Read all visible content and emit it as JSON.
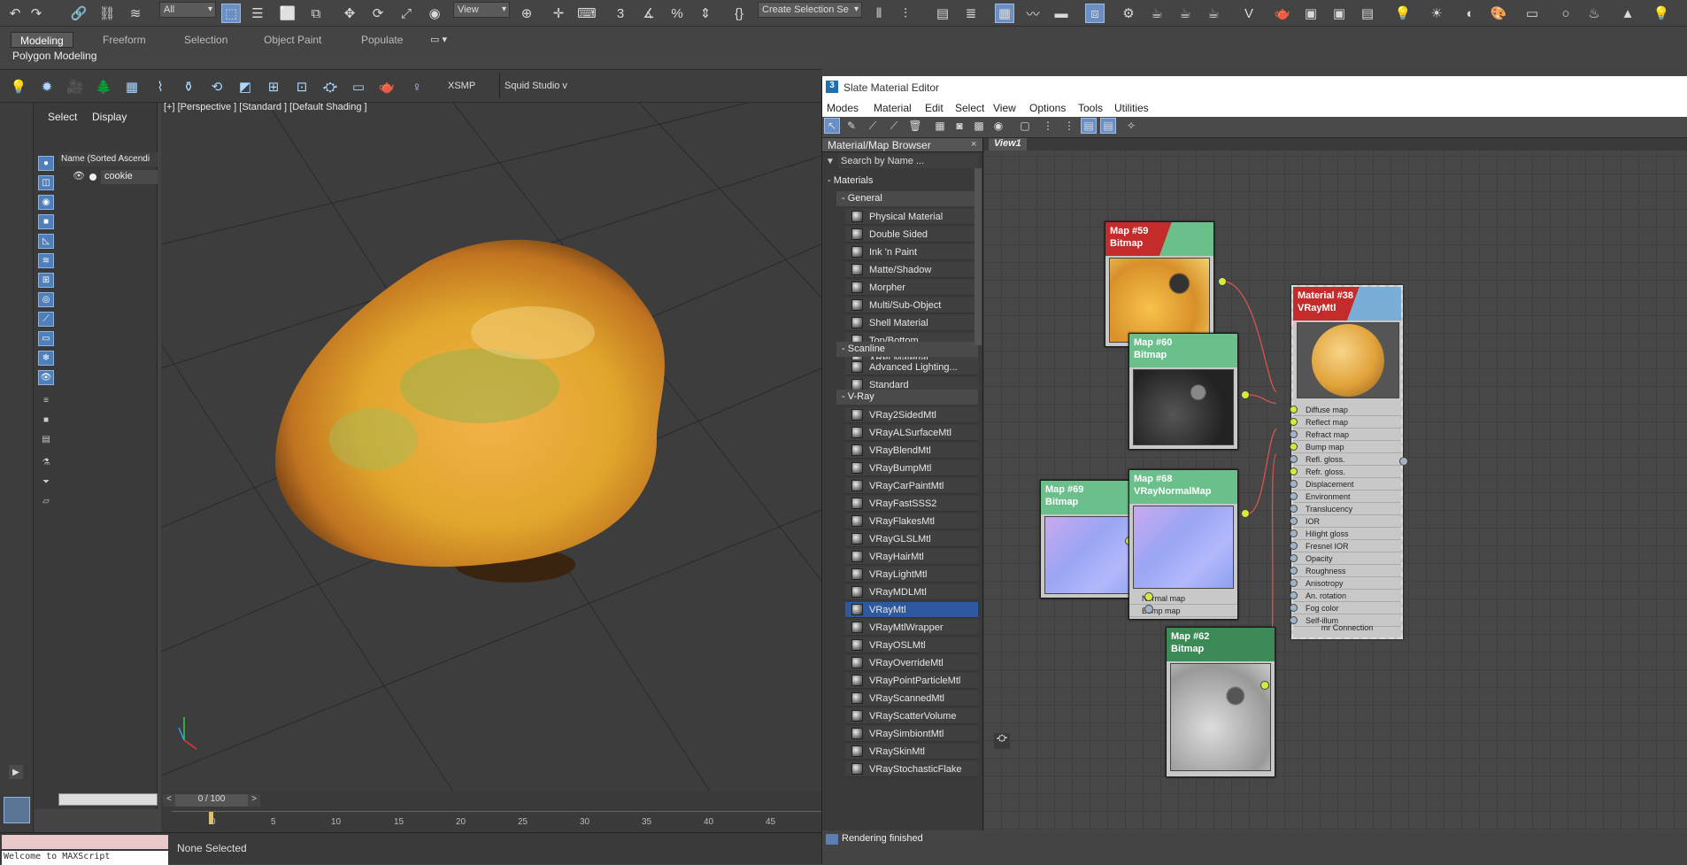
{
  "toolbar": {
    "filter_dropdown": "All",
    "view_dropdown": "View",
    "selection_set": "Create Selection Se"
  },
  "ribbon": {
    "tabs": [
      {
        "label": "Modeling"
      },
      {
        "label": "Freeform"
      },
      {
        "label": "Selection"
      },
      {
        "label": "Object Paint"
      },
      {
        "label": "Populate"
      }
    ],
    "subtitle": "Polygon Modeling",
    "xsmp": "XSMP",
    "squid": "Squid Studio v"
  },
  "scene_explorer": {
    "menu": [
      "Select",
      "Display"
    ],
    "column": "Name (Sorted Ascendi",
    "object": "cookie"
  },
  "viewport": {
    "label": "[+] [Perspective ] [Standard ] [Default Shading ]"
  },
  "timeline": {
    "counter": "0 / 100",
    "ticks": [
      "0",
      "5",
      "10",
      "15",
      "20",
      "25",
      "30",
      "35",
      "40",
      "45"
    ]
  },
  "status": {
    "none_selected": "None Selected",
    "script_line": "Welcome to MAXScript"
  },
  "sme": {
    "title": "Slate Material Editor",
    "menu": [
      "Modes",
      "Material",
      "Edit",
      "Select",
      "View",
      "Options",
      "Tools",
      "Utilities"
    ],
    "browser": {
      "title": "Material/Map Browser",
      "search": "Search by Name ...",
      "materials_label": "Materials",
      "general_label": "General",
      "general": [
        "Physical Material",
        "Double Sided",
        "Ink 'n Paint",
        "Matte/Shadow",
        "Morpher",
        "Multi/Sub-Object",
        "Shell Material",
        "Top/Bottom",
        "XRef Material"
      ],
      "scanline_label": "Scanline",
      "scanline": [
        "Advanced Lighting...",
        "Standard"
      ],
      "vray_label": "V-Ray",
      "vray": [
        "VRay2SidedMtl",
        "VRayALSurfaceMtl",
        "VRayBlendMtl",
        "VRayBumpMtl",
        "VRayCarPaintMtl",
        "VRayFastSSS2",
        "VRayFlakesMtl",
        "VRayGLSLMtl",
        "VRayHairMtl",
        "VRayLightMtl",
        "VRayMDLMtl",
        "VRayMtl",
        "VRayMtlWrapper",
        "VRayOSLMtl",
        "VRayOverrideMtl",
        "VRayPointParticleMtl",
        "VRayScannedMtl",
        "VRayScatterVolume",
        "VRaySimbiontMtl",
        "VRaySkinMtl",
        "VRayStochasticFlake"
      ],
      "selected": "VRayMtl"
    },
    "view_tab": "View1",
    "nodes": {
      "map59": {
        "name": "Map #59",
        "type": "Bitmap"
      },
      "map60": {
        "name": "Map #60",
        "type": "Bitmap"
      },
      "map69": {
        "name": "Map #69",
        "type": "Bitmap"
      },
      "map68": {
        "name": "Map #68",
        "type": "VRayNormalMap",
        "slots": [
          "Normal map",
          "Bump map"
        ]
      },
      "map62": {
        "name": "Map #62",
        "type": "Bitmap"
      },
      "mat": {
        "name": "Material #38",
        "type": "VRayMtl",
        "slots": [
          "Diffuse map",
          "Reflect map",
          "Refract map",
          "Bump map",
          "Refl. gloss.",
          "Refr. gloss.",
          "Displacement",
          "Environment",
          "Translucency",
          "IOR",
          "Hilight gloss",
          "Fresnel IOR",
          "Opacity",
          "Roughness",
          "Anisotropy",
          "An. rotation",
          "Fog color",
          "Self-illum"
        ],
        "footer": "mr Connection"
      }
    },
    "rendering": "Rendering finished"
  },
  "colors": {
    "accent": "#6b8fc4",
    "node_green": "#6bbf8a",
    "node_red": "#c42b2b",
    "wire": "#d9534f"
  }
}
